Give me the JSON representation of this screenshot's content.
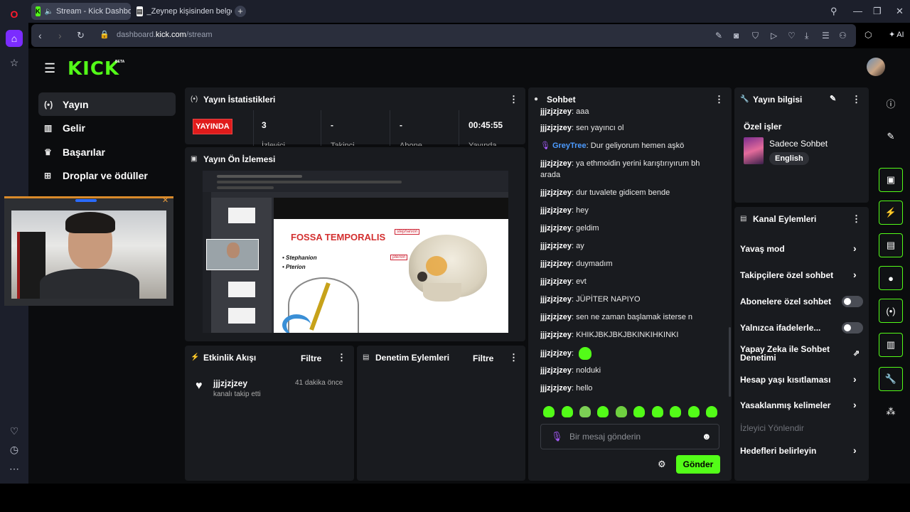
{
  "browser": {
    "tabs": [
      {
        "label": "Stream - Kick Dashboa",
        "favicon": "K"
      },
      {
        "label": "_Zeynep kişisinden belge.p"
      }
    ],
    "url_prefix": "dashboard.",
    "url_domain": "kick.com",
    "url_path": "/stream",
    "ai_label": "AI"
  },
  "header": {
    "logo": "KICK",
    "logo_badge": "BETA"
  },
  "sidebar": {
    "items": [
      {
        "label": "Yayın",
        "icon": "broadcast-icon"
      },
      {
        "label": "Gelir",
        "icon": "chart-icon"
      },
      {
        "label": "Başarılar",
        "icon": "trophy-icon"
      },
      {
        "label": "Droplar ve ödüller",
        "icon": "gift-icon"
      }
    ]
  },
  "stats": {
    "title": "Yayın İstatistikleri",
    "live": "YAYINDA",
    "values": [
      "3",
      "-",
      "-",
      "00:45:55"
    ],
    "labels": [
      "İzleyici",
      "Takipçi",
      "Abone",
      "Yayında"
    ]
  },
  "preview": {
    "title": "Yayın Ön İzlemesi",
    "doc_title": "FOSSA TEMPORALIS",
    "bullets": [
      "• Stephanion",
      "• Pterion"
    ],
    "labels": [
      "stephanion",
      "pterion"
    ]
  },
  "events": {
    "title": "Etkinlik Akışı",
    "filter": "Filtre",
    "item": {
      "user": "jjjzjzjzey",
      "desc": "kanalı takip etti",
      "time": "41 dakika önce"
    }
  },
  "moderation": {
    "title": "Denetim Eylemleri",
    "filter": "Filtre"
  },
  "chat": {
    "title": "Sohbet",
    "partial": {
      "user": "jjjzjzjzey",
      "text": "aaa"
    },
    "messages": [
      {
        "user": "jjjzjzjzey",
        "text": "sen yayıncı ol"
      },
      {
        "user": "GreyTree",
        "text": "Dur geliyorum hemen aşkö"
      },
      {
        "user": "jjjzjzjzey",
        "text": "ya ethmoidin yerini karıştırıyırum bh arada"
      },
      {
        "user": "jjjzjzjzey",
        "text": "dur tuvalete gidicem bende"
      },
      {
        "user": "jjjzjzjzey",
        "text": "hey"
      },
      {
        "user": "jjjzjzjzey",
        "text": "geldim"
      },
      {
        "user": "jjjzjzjzey",
        "text": "ay"
      },
      {
        "user": "jjjzjzjzey",
        "text": "duymadım"
      },
      {
        "user": "jjjzjzjzey",
        "text": "evt"
      },
      {
        "user": "jjjzjzjzey",
        "text": "JÜPİTER NAPIYO"
      },
      {
        "user": "jjjzjzjzey",
        "text": "sen ne zaman başlamak isterse n"
      },
      {
        "user": "jjjzjzjzey",
        "text": "KHIKJBKJBKJBKINKIHKINKI"
      },
      {
        "user": "jjjzjzjzey",
        "text": ""
      },
      {
        "user": "jjjzjzjzey",
        "text": "nolduki"
      },
      {
        "user": "jjjzjzjzey",
        "text": "hello"
      }
    ],
    "input_placeholder": "Bir mesaj gönderin",
    "send": "Gönder"
  },
  "stream_info": {
    "title": "Yayın bilgisi",
    "own_label": "Özel işler",
    "category": "Sadece Sohbet",
    "language": "English"
  },
  "channel_actions": {
    "title": "Kanal Eylemleri",
    "items": [
      {
        "label": "Yavaş mod",
        "control": "chevron"
      },
      {
        "label": "Takipçilere özel sohbet",
        "control": "chevron"
      },
      {
        "label": "Abonelere özel sohbet",
        "control": "toggle",
        "value": false
      },
      {
        "label": "Yalnızca ifadelerle...",
        "control": "toggle",
        "value": false
      },
      {
        "label": "Yapay Zeka ile Sohbet Denetimi",
        "control": "external"
      },
      {
        "label": "Hesap yaşı kısıtlaması",
        "control": "chevron"
      },
      {
        "label": "Yasaklanmış kelimeler",
        "control": "chevron"
      },
      {
        "label": "İzleyici Yönlendir",
        "control": "none",
        "disabled": true
      },
      {
        "label": "Hedefleri belirleyin",
        "control": "chevron"
      }
    ]
  },
  "colors": {
    "accent": "#53fc18",
    "live": "#e01b1b",
    "panel": "#191b1f",
    "background": "#0b0c0e"
  }
}
